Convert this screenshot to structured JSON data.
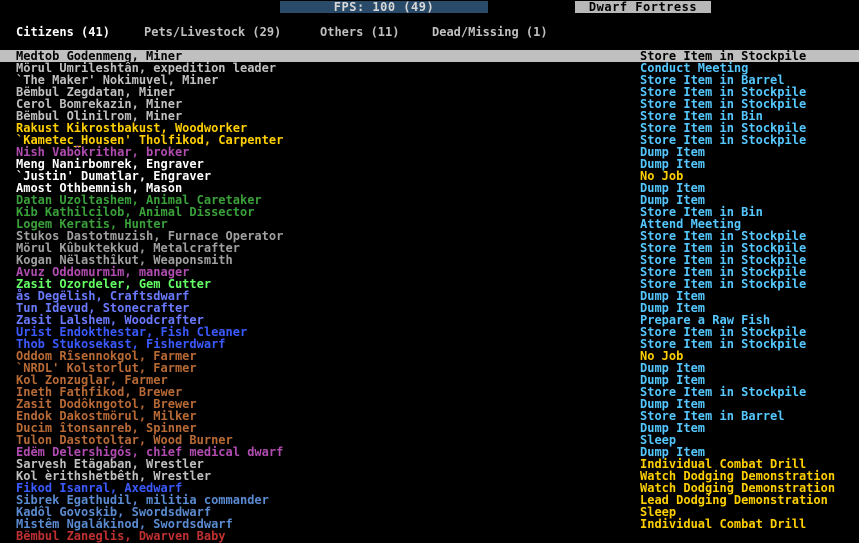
{
  "header": {
    "fps": "FPS: 100 (49)",
    "title": "Dwarf Fortress"
  },
  "tabs": [
    {
      "label": "Citizens (41)",
      "active": true
    },
    {
      "label": "Pets/Livestock (29)",
      "active": false
    },
    {
      "label": "Others (11)",
      "active": false
    },
    {
      "label": "Dead/Missing (1)",
      "active": false
    }
  ],
  "colors": {
    "selected_bg": "#c0c0c0",
    "job_active": "#55c8ff",
    "job_idle": "#ffd000"
  },
  "units": [
    {
      "name": "Medtob Godenmeng, Miner",
      "job": "Store Item in Stockpile",
      "color": "#000000",
      "jobColor": "#000000",
      "selected": true
    },
    {
      "name": "Mörul Umrileshtân, expedition leader",
      "job": "Conduct Meeting",
      "color": "#c0c0c0",
      "jobColor": "#55c8ff"
    },
    {
      "name": "`The Maker' Nokimuvel, Miner",
      "job": "Store Item in Barrel",
      "color": "#c0c0c0",
      "jobColor": "#55c8ff"
    },
    {
      "name": "Bëmbul Zegdatan, Miner",
      "job": "Store Item in Stockpile",
      "color": "#c0c0c0",
      "jobColor": "#55c8ff"
    },
    {
      "name": "Cerol Bomrekazin, Miner",
      "job": "Store Item in Stockpile",
      "color": "#c0c0c0",
      "jobColor": "#55c8ff"
    },
    {
      "name": "Bëmbul Olinilrom, Miner",
      "job": "Store Item in Bin",
      "color": "#c0c0c0",
      "jobColor": "#55c8ff"
    },
    {
      "name": "Rakust Kikrostbakust, Woodworker",
      "job": "Store Item in Stockpile",
      "color": "#ffd000",
      "jobColor": "#55c8ff"
    },
    {
      "name": "`Kametec_Housen' Tholfikod, Carpenter",
      "job": "Store Item in Stockpile",
      "color": "#ffd000",
      "jobColor": "#55c8ff"
    },
    {
      "name": "Nish Vabôkrithar, broker",
      "job": "Dump Item",
      "color": "#b04cb0",
      "jobColor": "#55c8ff"
    },
    {
      "name": "Meng Nanirbomrek, Engraver",
      "job": "Dump Item",
      "color": "#ffffff",
      "jobColor": "#55c8ff"
    },
    {
      "name": "`Justin' Dumatlar, Engraver",
      "job": "No Job",
      "color": "#ffffff",
      "jobColor": "#ffd000"
    },
    {
      "name": "Amost Othbemnish, Mason",
      "job": "Dump Item",
      "color": "#ffffff",
      "jobColor": "#55c8ff"
    },
    {
      "name": "Datan Uzoltashem, Animal Caretaker",
      "job": "Dump Item",
      "color": "#3aa03a",
      "jobColor": "#55c8ff"
    },
    {
      "name": "Kib Kathilcilob, Animal Dissector",
      "job": "Store Item in Bin",
      "color": "#3aa03a",
      "jobColor": "#55c8ff"
    },
    {
      "name": "Logem Keratis, Hunter",
      "job": "Attend Meeting",
      "color": "#3aa03a",
      "jobColor": "#55c8ff"
    },
    {
      "name": "Stukos Dastotmuzish, Furnace Operator",
      "job": "Store Item in Stockpile",
      "color": "#a0a0a0",
      "jobColor": "#55c8ff"
    },
    {
      "name": "Mörul Kûbuktekkud, Metalcrafter",
      "job": "Store Item in Stockpile",
      "color": "#a0a0a0",
      "jobColor": "#55c8ff"
    },
    {
      "name": "Kogan Nëlasthîkut, Weaponsmith",
      "job": "Store Item in Stockpile",
      "color": "#a0a0a0",
      "jobColor": "#55c8ff"
    },
    {
      "name": "Avuz Oddomurmim, manager",
      "job": "Store Item in Stockpile",
      "color": "#b04cb0",
      "jobColor": "#55c8ff"
    },
    {
      "name": "Zasit Ozordeler, Gem Cutter",
      "job": "Store Item in Stockpile",
      "color": "#66ff66",
      "jobColor": "#55c8ff"
    },
    {
      "name": "ås Degëlish, Craftsdwarf",
      "job": "Dump Item",
      "color": "#6a7aff",
      "jobColor": "#55c8ff"
    },
    {
      "name": "Tun Idevud, Stonecrafter",
      "job": "Dump Item",
      "color": "#6a7aff",
      "jobColor": "#55c8ff"
    },
    {
      "name": "Zasit Lalshem, Woodcrafter",
      "job": "Prepare a Raw Fish",
      "color": "#6a7aff",
      "jobColor": "#55c8ff"
    },
    {
      "name": "Urist Endokthestar, Fish Cleaner",
      "job": "Store Item in Stockpile",
      "color": "#3a5aff",
      "jobColor": "#55c8ff"
    },
    {
      "name": "Thob Stukosekast, Fisherdwarf",
      "job": "Store Item in Stockpile",
      "color": "#3a5aff",
      "jobColor": "#55c8ff"
    },
    {
      "name": "Oddom Rîsennokgol, Farmer",
      "job": "No Job",
      "color": "#b86a36",
      "jobColor": "#ffd000"
    },
    {
      "name": "`NRDL' Kolstorlut, Farmer",
      "job": "Dump Item",
      "color": "#b86a36",
      "jobColor": "#55c8ff"
    },
    {
      "name": "Kol Zonzuglar, Farmer",
      "job": "Dump Item",
      "color": "#b86a36",
      "jobColor": "#55c8ff"
    },
    {
      "name": "Ineth Fathfikod, Brewer",
      "job": "Store Item in Stockpile",
      "color": "#b86a36",
      "jobColor": "#55c8ff"
    },
    {
      "name": "Zasit Dodôkngotol, Brewer",
      "job": "Dump Item",
      "color": "#b86a36",
      "jobColor": "#55c8ff"
    },
    {
      "name": "Endok Dakostmörul, Milker",
      "job": "Store Item in Barrel",
      "color": "#b86a36",
      "jobColor": "#55c8ff"
    },
    {
      "name": "Ducim îtonsanreb, Spinner",
      "job": "Dump Item",
      "color": "#b86a36",
      "jobColor": "#55c8ff"
    },
    {
      "name": "Tulon Dastotoltar, Wood Burner",
      "job": "Sleep",
      "color": "#b86a36",
      "jobColor": "#55c8ff"
    },
    {
      "name": "Edëm Delershigós, chief medical dwarf",
      "job": "Dump Item",
      "color": "#b04cb0",
      "jobColor": "#55c8ff"
    },
    {
      "name": "Sarvesh Etägaban, Wrestler",
      "job": "Individual Combat Drill",
      "color": "#c0c0c0",
      "jobColor": "#ffd000"
    },
    {
      "name": "Kol èrithshetbêth, Wrestler",
      "job": "Watch Dodging Demonstration",
      "color": "#c0c0c0",
      "jobColor": "#ffd000"
    },
    {
      "name": "Fikod Isanral, Axedwarf",
      "job": "Watch Dodging Demonstration",
      "color": "#3a5aff",
      "jobColor": "#ffd000"
    },
    {
      "name": "Sibrek Egathudil, militia commander",
      "job": "Lead Dodging Demonstration",
      "color": "#5a8ad0",
      "jobColor": "#ffd000"
    },
    {
      "name": "Kadôl Govoskib, Swordsdwarf",
      "job": "Sleep",
      "color": "#5a8ad0",
      "jobColor": "#ffd000"
    },
    {
      "name": "Mistêm Ngalákinod, Swordsdwarf",
      "job": "Individual Combat Drill",
      "color": "#5a8ad0",
      "jobColor": "#ffd000"
    },
    {
      "name": "Bëmbul Zaneglis, Dwarven Baby",
      "job": "",
      "color": "#c03030",
      "jobColor": "#55c8ff"
    }
  ]
}
